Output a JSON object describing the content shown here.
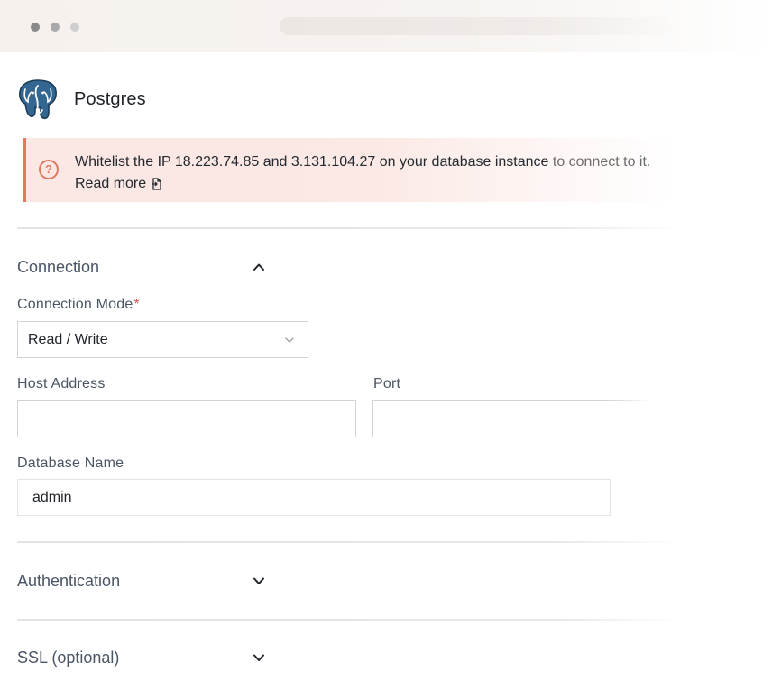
{
  "app": {
    "title": "Postgres"
  },
  "alert": {
    "text_main": "Whitelist the IP 18.223.74.85 and 3.131.104.27 on your database instance",
    "text_fade": " to connect to it.",
    "read_more": "Read more",
    "icon": "question-circle-icon",
    "accent_color": "#e07a5f"
  },
  "sections": {
    "connection": {
      "title": "Connection",
      "expanded": true,
      "icon": "chevron-up-icon"
    },
    "authentication": {
      "title": "Authentication",
      "expanded": false,
      "icon": "chevron-down-icon"
    },
    "ssl": {
      "title": "SSL (optional)",
      "expanded": false,
      "icon": "chevron-down-icon"
    }
  },
  "fields": {
    "connection_mode": {
      "label": "Connection Mode",
      "required_mark": "*",
      "value": "Read / Write"
    },
    "host_address": {
      "label": "Host Address",
      "value": "",
      "placeholder": ""
    },
    "port": {
      "label": "Port",
      "value": "",
      "placeholder": ""
    },
    "database_name": {
      "label": "Database Name",
      "value": "admin"
    }
  },
  "colors": {
    "label": "#4a5566",
    "border": "#d0d4d9",
    "required": "#d9534f",
    "logo_blue": "#336791"
  }
}
